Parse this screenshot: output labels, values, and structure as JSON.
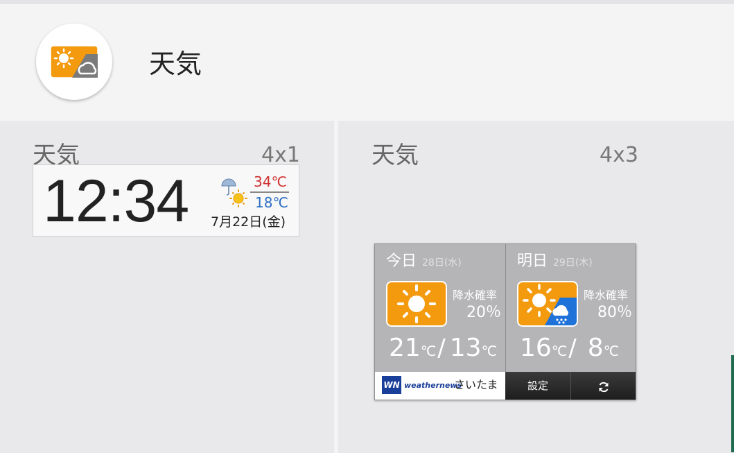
{
  "header": {
    "title": "天気",
    "app_icon": "weather-app-icon"
  },
  "widgets": [
    {
      "name": "天気",
      "size": "4x1",
      "preview": {
        "time": "12:34",
        "high": "34℃",
        "low": "18℃",
        "date": "7月22日(金)",
        "icon": "rain-then-sun-icon"
      }
    },
    {
      "name": "天気",
      "size": "4x3",
      "preview": {
        "today": {
          "label": "今日",
          "date": "28日(水)",
          "icon": "sun-icon",
          "precip_label": "降水確率",
          "precip": "20％",
          "high": "21",
          "low": "13",
          "unit": "℃"
        },
        "tomorrow": {
          "label": "明日",
          "date": "29日(木)",
          "icon": "sun-cloud-rain-icon",
          "precip_label": "降水確率",
          "precip": "80％",
          "high": "16",
          "low": "8",
          "unit": "℃"
        },
        "brand": "weathernews",
        "brand_mark": "WN",
        "city": "さいたま",
        "settings_label": "設定",
        "refresh_icon": "refresh-icon"
      }
    }
  ],
  "colors": {
    "accent_orange": "#f39a0f",
    "high_temp": "#d03030",
    "low_temp": "#2a6cc0",
    "brand_blue": "#1a3f9a"
  }
}
